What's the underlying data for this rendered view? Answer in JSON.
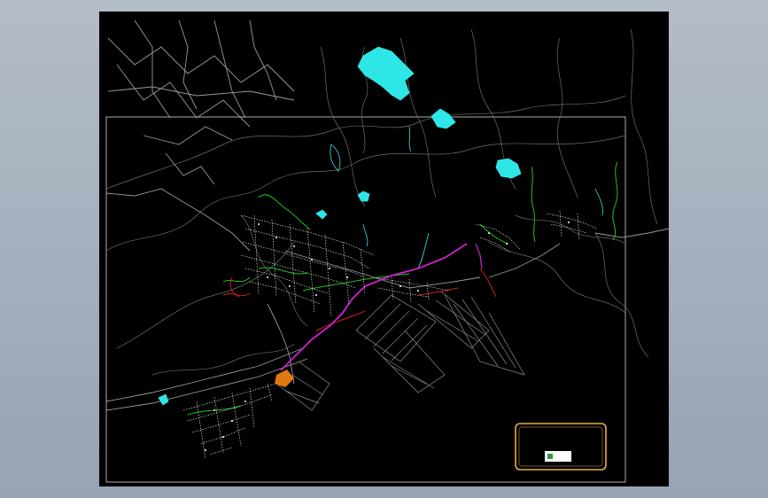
{
  "title_block": {
    "title": "",
    "subtitle": "",
    "logo_text": ""
  },
  "colors": {
    "background": "#000000",
    "outer": "#a6afbd",
    "frame": "#d8d8d8",
    "roads_gray": "#8c8c8c",
    "water": "#2ee6e6",
    "pipe_green": "#20c020",
    "pipe_magenta": "#d020d0",
    "pipe_red": "#d02020",
    "node_white": "#ffffff",
    "highlight_orange": "#e07a10",
    "title_frame": "#e8b040"
  }
}
